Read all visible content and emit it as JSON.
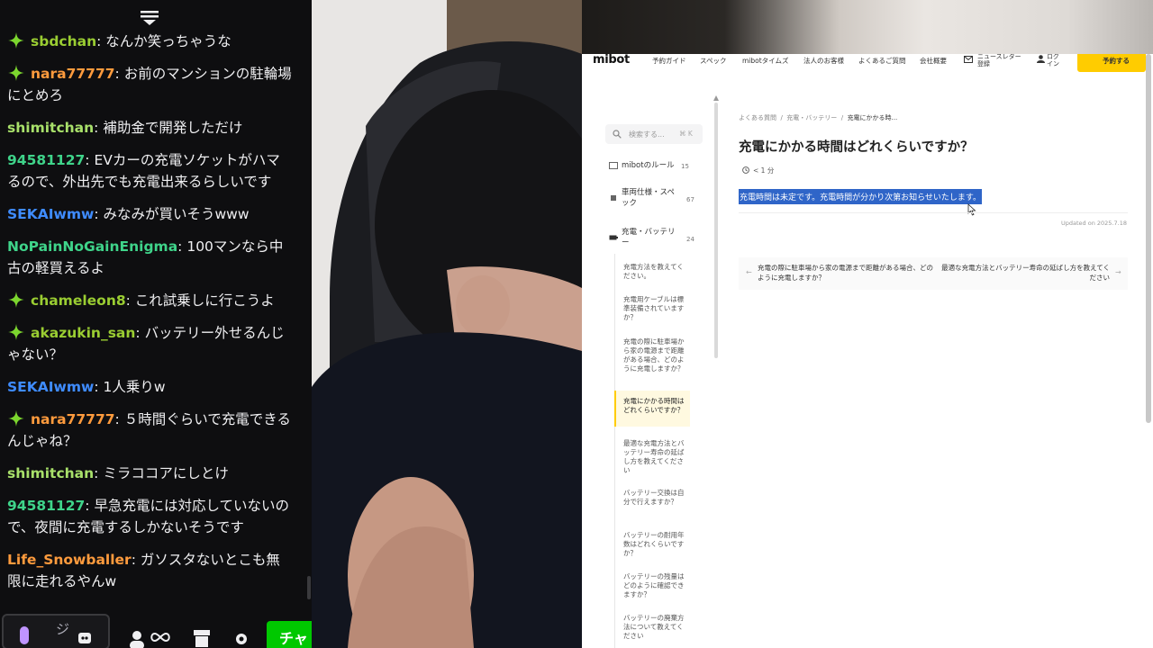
{
  "chat": {
    "messages": [
      {
        "user": "sbdchan",
        "text": "なんか笑っちゃうな",
        "color": "#9acd32",
        "badge": true
      },
      {
        "user": "nara77777",
        "text": "お前のマンションの駐輪場にとめろ",
        "color": "#ff9b3d",
        "badge": true
      },
      {
        "user": "shimitchan",
        "text": "補助金で開発しただけ",
        "color": "#a8e06a",
        "badge": false
      },
      {
        "user": "94581127",
        "text": "EVカーの充電ソケットがハマるので、外出先でも充電出来るらしいです",
        "color": "#3fd48a",
        "badge": false
      },
      {
        "user": "SEKAIwmw",
        "text": "みなみが買いそうwww",
        "color": "#3f8cff",
        "badge": false
      },
      {
        "user": "NoPainNoGainEnigma",
        "text": "100マンなら中古の軽買えるよ",
        "color": "#3fd48a",
        "badge": false
      },
      {
        "user": "chameleon8",
        "text": "これ試乗しに行こうよ",
        "color": "#9acd32",
        "badge": true
      },
      {
        "user": "akazukin_san",
        "text": "バッテリー外せるんじゃない？",
        "color": "#9acd32",
        "badge": true
      },
      {
        "user": "SEKAIwmw",
        "text": "1人乗りw",
        "color": "#3f8cff",
        "badge": false
      },
      {
        "user": "nara77777",
        "text": "５時間ぐらいで充電できるんじゃね？",
        "color": "#ff9b3d",
        "badge": true
      },
      {
        "user": "shimitchan",
        "text": "ミラココアにしとけ",
        "color": "#a8e06a",
        "badge": false
      },
      {
        "user": "94581127",
        "text": "早急充電には対応していないので、夜間に充電するしかないそうです",
        "color": "#3fd48a",
        "badge": false
      },
      {
        "user": "Life_Snowballer",
        "text": "ガソスタないとこも無限に走れるやんw",
        "color": "#ff9b3d",
        "badge": false
      }
    ],
    "input_text": "ジ",
    "send_label": "チャ"
  },
  "site": {
    "logo": "mibot",
    "nav": [
      "予約ガイド",
      "スペック",
      "mibotタイムズ",
      "法人のお客様",
      "よくあるご質問",
      "会社概要"
    ],
    "newsletter": "ニュースレター登録",
    "login": "ログイン",
    "reserve": "予約する",
    "search": {
      "placeholder": "検索する...",
      "shortcut": "⌘ K"
    },
    "categories": [
      {
        "label": "mibotのルール",
        "count": "15"
      },
      {
        "label": "車両仕様・スペック",
        "count": "67"
      },
      {
        "label": "充電・バッテリー",
        "count": "24"
      }
    ],
    "subitems": [
      "充電方法を教えてください。",
      "充電用ケーブルは標準装備されていますか？",
      "充電の際に駐車場から家の電源まで距離がある場合、どのように充電しますか？",
      "充電にかかる時間はどれくらいですか？",
      "最適な充電方法とバッテリー寿命の延ばし方を教えてください",
      "バッテリー交換は自分で行えますか？",
      "バッテリーの耐用年数はどれくらいですか？",
      "バッテリーの残量はどのように確認できますか？",
      "バッテリーの廃棄方法について教えてください"
    ],
    "breadcrumb": [
      "よくある質問",
      "充電・バッテリー",
      "充電にかかる時..."
    ],
    "title": "充電にかかる時間はどれくらいですか？",
    "read_time": "< 1 分",
    "answer": "充電時間は未定です。充電時間が分かり次第お知らせいたします。",
    "updated": "Updated on 2025.7.18",
    "prev": "充電の際に駐車場から家の電源まで距離がある場合、どのように充電しますか？",
    "next": "最適な充電方法とバッテリー寿命の延ばし方を教えてください",
    "accent": "#ffcc00",
    "highlight": "#2f65c8"
  }
}
